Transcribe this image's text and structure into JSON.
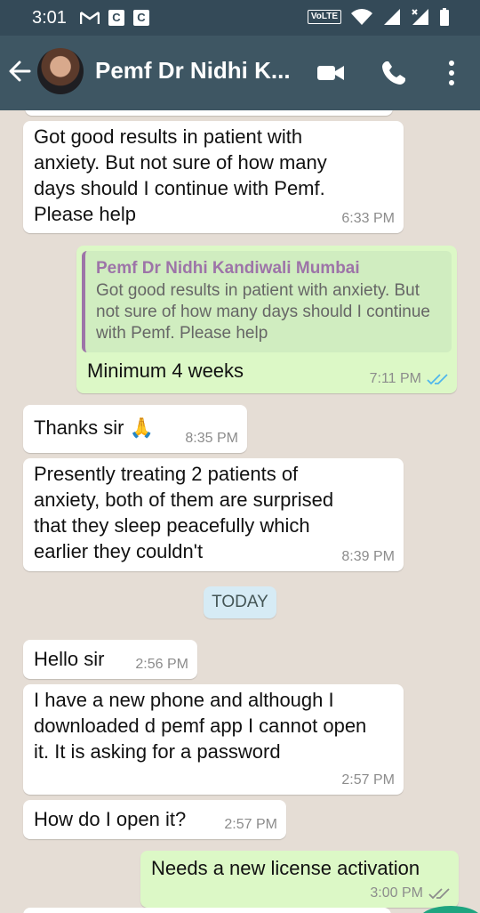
{
  "status_bar": {
    "time": "3:01",
    "left_icons": [
      "gmail-icon",
      "c-icon",
      "c-icon"
    ],
    "volte": "VoLTE",
    "right_icons": [
      "wifi-icon",
      "signal-icon",
      "signal-icon",
      "battery-icon"
    ]
  },
  "header": {
    "title": "Pemf Dr Nidhi K...",
    "icons": [
      "back-arrow-icon",
      "avatar",
      "video-call-icon",
      "phone-call-icon",
      "more-options-icon"
    ]
  },
  "messages": [
    {
      "dir": "in",
      "text": "Got good results in patient with anxiety. But not sure of how many days should I continue with Pemf. Please help",
      "time": "6:33 PM"
    },
    {
      "dir": "out",
      "quote_name": "Pemf Dr Nidhi Kandiwali Mumbai",
      "quote_text": "Got good results in patient with anxiety. But not sure of how many days should I continue with Pemf. Please help",
      "text": "Minimum 4 weeks",
      "time": "7:11 PM",
      "ticks": "read"
    },
    {
      "dir": "in",
      "text": "Thanks sir 🙏",
      "time": "8:35 PM"
    },
    {
      "dir": "in",
      "text": "Presently treating 2 patients of anxiety, both of them are surprised that they sleep peacefully which earlier they couldn't",
      "time": "8:39 PM"
    },
    {
      "dir": "in",
      "text": "Hello sir",
      "time": "2:56 PM"
    },
    {
      "dir": "in",
      "text": "I have a new phone and although I downloaded d pemf app I cannot open it. It is asking for a password",
      "time": "2:57 PM"
    },
    {
      "dir": "in",
      "text": "How do I open it?",
      "time": "2:57 PM"
    },
    {
      "dir": "out",
      "text": "Needs a new license activation",
      "time": "3:00 PM",
      "ticks": "delivered"
    }
  ],
  "date_divider": "TODAY",
  "colors": {
    "appbar": "#3e5663",
    "statusbar": "#344a58",
    "chat_bg": "#e5ddd5",
    "outgoing": "#dcf8c6",
    "incoming": "#ffffff",
    "quote_name": "#9d74a8",
    "read_ticks": "#4fb6ec"
  }
}
